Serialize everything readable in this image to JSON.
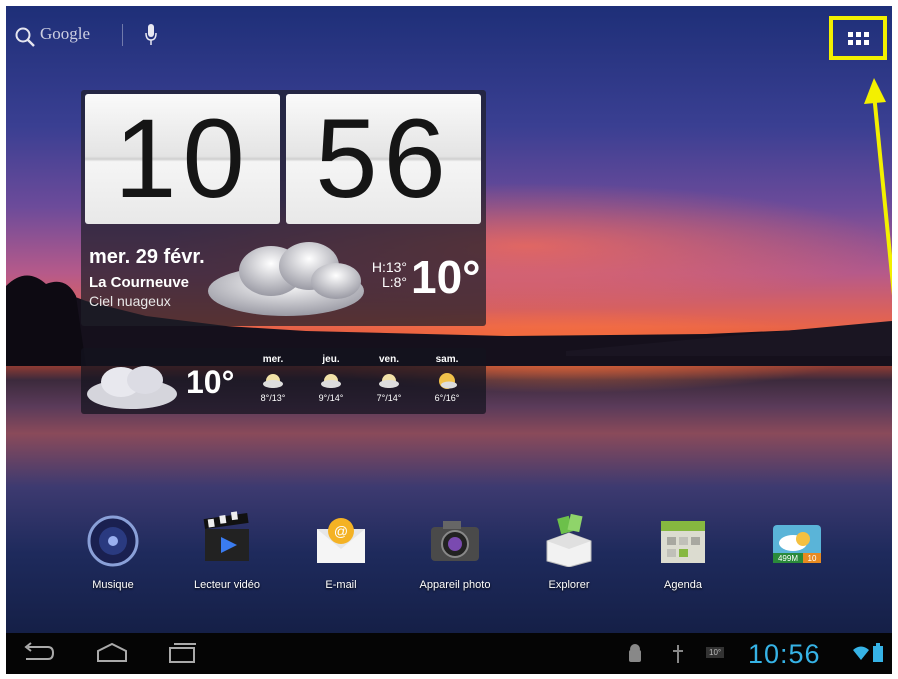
{
  "search": {
    "label": "Google"
  },
  "clock": {
    "hours": "10",
    "minutes": "56"
  },
  "weather": {
    "date": "mer. 29 févr.",
    "city": "La Courneuve",
    "condition": "Ciel nuageux",
    "high": "H:13°",
    "low": "L:8°",
    "temperature": "10°"
  },
  "forecast": {
    "current_temp": "10°",
    "days": [
      {
        "name": "mer.",
        "range": "8°/13°"
      },
      {
        "name": "jeu.",
        "range": "9°/14°"
      },
      {
        "name": "ven.",
        "range": "7°/14°"
      },
      {
        "name": "sam.",
        "range": "6°/16°"
      }
    ]
  },
  "dock": {
    "apps": [
      {
        "label": "Musique"
      },
      {
        "label": "Lecteur vidéo"
      },
      {
        "label": "E-mail"
      },
      {
        "label": "Appareil photo"
      },
      {
        "label": "Explorer"
      },
      {
        "label": "Agenda"
      },
      {
        "label": ""
      }
    ],
    "memory_badge": "499M",
    "memory_count": "10"
  },
  "status": {
    "time": "10:56",
    "temp_badge": "10°"
  },
  "colors": {
    "highlight": "#f3f000",
    "clock_accent": "#36b3e6"
  }
}
